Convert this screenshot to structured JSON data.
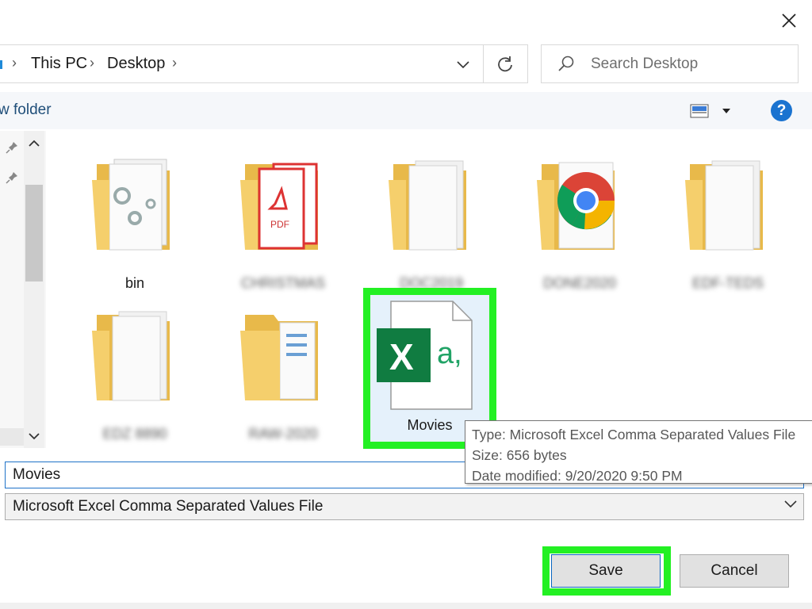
{
  "address": {
    "crumbs": [
      "This PC",
      "Desktop"
    ],
    "separator": "›"
  },
  "search": {
    "placeholder": "Search Desktop"
  },
  "toolbar": {
    "new_folder_label": "w folder",
    "help_label": "?"
  },
  "folders": [
    {
      "label": "bin",
      "icon": "folder-gears-icon",
      "blurred": false
    },
    {
      "label": "CHRISTMAS",
      "icon": "folder-pdf-icon",
      "blurred": true
    },
    {
      "label": "DOC2019",
      "icon": "folder-docs-icon",
      "blurred": true
    },
    {
      "label": "DONE2020",
      "icon": "folder-chrome-icon",
      "blurred": true
    },
    {
      "label": "EDF-TEDS",
      "icon": "folder-docs-icon",
      "blurred": true
    },
    {
      "label": "EDZ 8890",
      "icon": "folder-docs-icon",
      "blurred": true
    },
    {
      "label": "RAW-2020",
      "icon": "folder-docs-icon",
      "blurred": true
    }
  ],
  "selected_file": {
    "label": "Movies",
    "icon": "excel-csv-icon"
  },
  "tooltip": {
    "type": "Type: Microsoft Excel Comma Separated Values File",
    "size": "Size: 656 bytes",
    "modified": "Date modified: 9/20/2020 9:50 PM"
  },
  "file_name": {
    "value": "Movies"
  },
  "file_type": {
    "value": "Microsoft Excel Comma Separated Values File"
  },
  "buttons": {
    "save": "Save",
    "cancel": "Cancel"
  },
  "colors": {
    "highlight": "#23f023",
    "accent": "#1a73d0",
    "excel_green": "#107c41"
  }
}
